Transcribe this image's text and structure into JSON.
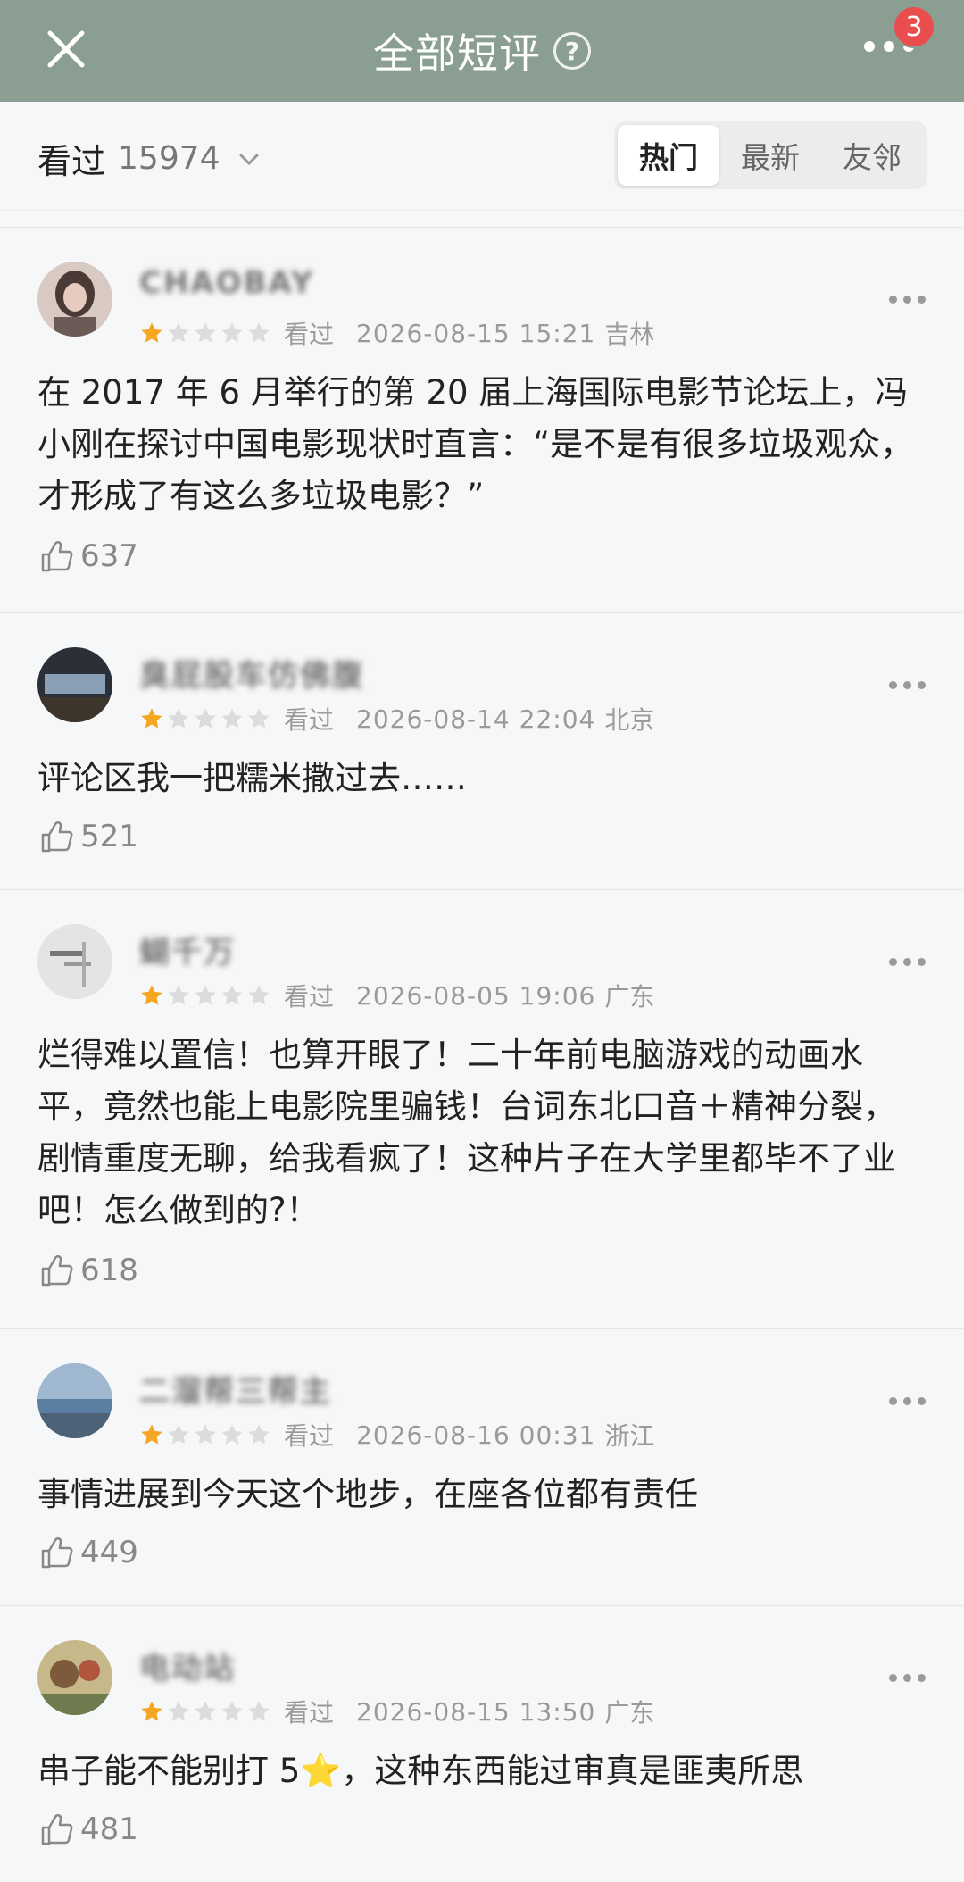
{
  "header": {
    "title": "全部短评",
    "help": "?",
    "badge": "3"
  },
  "filter": {
    "watched_label": "看过",
    "watched_count": "15974",
    "tabs": [
      {
        "label": "热门"
      },
      {
        "label": "最新"
      },
      {
        "label": "友邻"
      }
    ]
  },
  "colors": {
    "header_bg": "#8a9e92",
    "star_filled": "#f5a623",
    "star_empty": "#dcdcdc",
    "badge": "#e94d4d"
  },
  "comments": [
    {
      "user": "CHAOBAY",
      "rating": 1,
      "status": "看过",
      "date": "2026-08-15 15:21",
      "location": "吉林",
      "text": "在 2017 年 6 月举行的第 20 届上海国际电影节论坛上，冯小刚在探讨中国电影现状时直言：“是不是有很多垃圾观众，才形成了有这么多垃圾电影？”",
      "likes": "637"
    },
    {
      "user": "臭屁股车仿佛腹",
      "rating": 1,
      "status": "看过",
      "date": "2026-08-14 22:04",
      "location": "北京",
      "text": "评论区我一把糯米撒过去……",
      "likes": "521"
    },
    {
      "user": "蝴千万",
      "rating": 1,
      "status": "看过",
      "date": "2026-08-05 19:06",
      "location": "广东",
      "text": "烂得难以置信！也算开眼了！二十年前电脑游戏的动画水平，竟然也能上电影院里骗钱！台词东北口音＋精神分裂，剧情重度无聊，给我看疯了！这种片子在大学里都毕不了业吧！怎么做到的?！",
      "likes": "618"
    },
    {
      "user": "二溜帮三帮主",
      "rating": 1,
      "status": "看过",
      "date": "2026-08-16 00:31",
      "location": "浙江",
      "text": "事情进展到今天这个地步，在座各位都有责任",
      "likes": "449"
    },
    {
      "user": "电动站",
      "rating": 1,
      "status": "看过",
      "date": "2026-08-15 13:50",
      "location": "广东",
      "text": "串子能不能别打 5⭐，这种东西能过审真是匪夷所思",
      "likes": "481"
    }
  ]
}
